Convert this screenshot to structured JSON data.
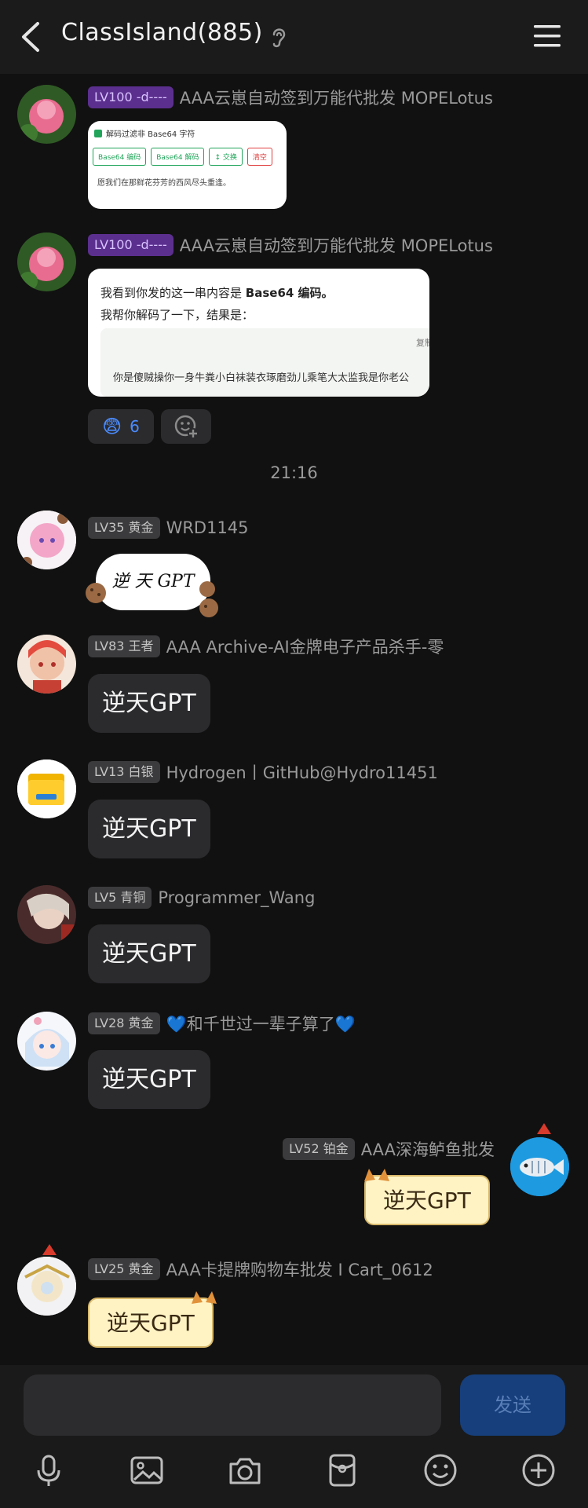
{
  "header": {
    "title": "ClassIsland(885)"
  },
  "messages": [
    {
      "badge": "LV100 -d----",
      "nick": "AAA云崽自动签到万能代批发 MOPELotus",
      "image1": {
        "check_label": "解码过滤非 Base64 字符",
        "buttons": [
          "Base64 编码",
          "Base64 解码",
          "↕ 交换",
          "清空"
        ],
        "body": "愿我们在那鲜花芬芳的西风尽头重逢。"
      }
    },
    {
      "badge": "LV100 -d----",
      "nick": "AAA云崽自动签到万能代批发 MOPELotus",
      "image2": {
        "line1_prefix": "我看到你发的这一串内容是 ",
        "line1_bold": "Base64 编码。",
        "line2": "我帮你解码了一下，结果是：",
        "copy": "复制",
        "decoded": "你是傻贼操你一身牛粪小白袜装衣琢磨劲儿乘笔大太监我是你老公"
      },
      "reaction_count": "6"
    }
  ],
  "timestamp": "21:16",
  "chat": [
    {
      "badge": "LV35 黄金",
      "nick": "WRD1145",
      "text": "逆 天 GPT"
    },
    {
      "badge": "LV83 王者",
      "nick": "AAA Archive-AI金牌电子产品杀手-零",
      "text": "逆天GPT"
    },
    {
      "badge": "LV13 白银",
      "nick": "Hydrogen丨GitHub@Hydro11451",
      "text": "逆天GPT"
    },
    {
      "badge": "LV5 青铜",
      "nick": "Programmer_Wang",
      "text": "逆天GPT"
    },
    {
      "badge": "LV28 黄金",
      "nick": "💙和千世过一辈子算了💙",
      "text": "逆天GPT"
    },
    {
      "badge": "LV52 铂金",
      "nick": "AAA深海鲈鱼批发",
      "text": "逆天GPT"
    },
    {
      "badge": "LV25 黄金",
      "nick": "AAA卡提牌购物车批发 I Cart_0612",
      "text": "逆天GPT"
    }
  ],
  "composer": {
    "send_label": "发送"
  },
  "colors": {
    "accent": "#163f7b",
    "send_text": "#5a7fb8",
    "bubble": "#2b2b2e"
  },
  "toolbar_icons": [
    "mic-icon",
    "image-icon",
    "camera-icon",
    "red-packet-icon",
    "emoji-icon",
    "plus-icon"
  ]
}
